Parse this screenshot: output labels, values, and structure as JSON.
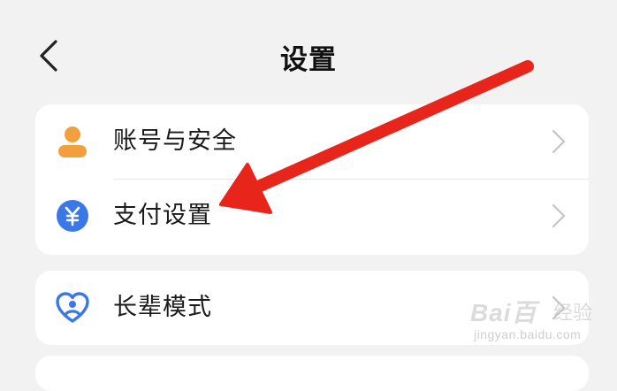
{
  "header": {
    "title": "设置"
  },
  "settings_group_1": {
    "items": [
      {
        "label": "账号与安全",
        "icon": "account-person-icon",
        "color": "#f2a03d"
      },
      {
        "label": "支付设置",
        "icon": "yuan-payment-icon",
        "color": "#3b78e7"
      }
    ]
  },
  "settings_group_2": {
    "items": [
      {
        "label": "长辈模式",
        "icon": "heart-person-icon",
        "color": "#3b78e7"
      }
    ]
  },
  "annotation": {
    "color": "#e8251b"
  },
  "watermark": {
    "brand": "Bai百",
    "suffix": "经验",
    "url": "jingyan.baidu.com"
  }
}
